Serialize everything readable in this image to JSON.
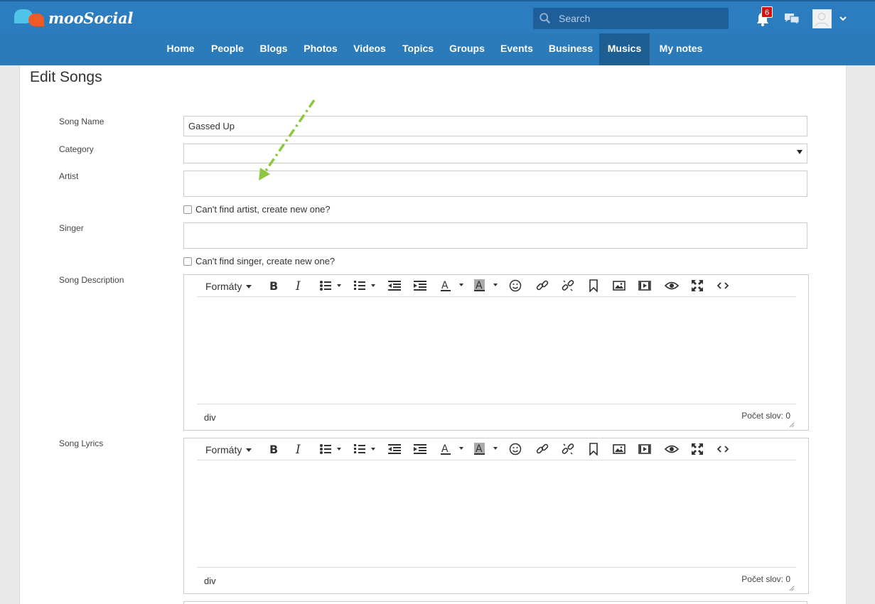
{
  "brand": {
    "name": "mooSocial"
  },
  "search": {
    "placeholder": "Search"
  },
  "header": {
    "notification_count": "6"
  },
  "nav": {
    "items": [
      {
        "label": "Home"
      },
      {
        "label": "People"
      },
      {
        "label": "Blogs"
      },
      {
        "label": "Photos"
      },
      {
        "label": "Videos"
      },
      {
        "label": "Topics"
      },
      {
        "label": "Groups"
      },
      {
        "label": "Events"
      },
      {
        "label": "Business"
      },
      {
        "label": "Musics"
      },
      {
        "label": "My notes"
      }
    ],
    "active": "Musics"
  },
  "page": {
    "title": "Edit Songs"
  },
  "form": {
    "song_name_label": "Song Name",
    "song_name_value": "Gassed Up",
    "category_label": "Category",
    "category_value": "",
    "artist_label": "Artist",
    "artist_value": "",
    "artist_checkbox_label": "Can't find artist, create new one?",
    "singer_label": "Singer",
    "singer_value": "",
    "singer_checkbox_label": "Can't find singer, create new one?",
    "description_label": "Song Description",
    "lyrics_label": "Song Lyrics"
  },
  "editor": {
    "formats_label": "Formáty",
    "path_label": "div",
    "word_count_label": "Počet slov: 0"
  },
  "colors": {
    "header_bg": "#2c7cc0",
    "nav_active_bg": "#1d5e93",
    "badge": "#d41010",
    "annotation_arrow": "#8dc63f"
  }
}
